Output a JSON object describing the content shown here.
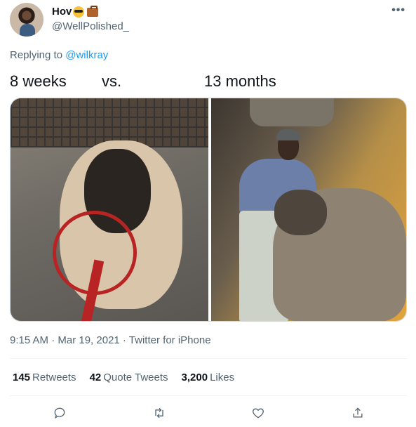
{
  "author": {
    "display_name": "Hov",
    "emojis": [
      "sunglasses-emoji",
      "briefcase-emoji"
    ],
    "handle": "@WellPolished_"
  },
  "replying": {
    "prefix": "Replying to",
    "mention": "@wilkray"
  },
  "tweet": {
    "text_parts": [
      "8 weeks",
      "vs.",
      "13 months"
    ]
  },
  "media": [
    {
      "name": "puppy-photo"
    },
    {
      "name": "grown-dog-photo"
    }
  ],
  "meta": {
    "timestamp": "9:15 AM · Mar 19, 2021 · Twitter for iPhone"
  },
  "stats": {
    "retweets_count": "145",
    "retweets_label": "Retweets",
    "quotes_count": "42",
    "quotes_label": "Quote Tweets",
    "likes_count": "3,200",
    "likes_label": "Likes"
  },
  "icons": {
    "more": "more-icon",
    "reply": "reply-icon",
    "retweet": "retweet-icon",
    "like": "heart-icon",
    "share": "share-icon"
  },
  "colors": {
    "accent": "#1d9bf0",
    "secondary_text": "#536471",
    "primary_text": "#0f1419"
  }
}
